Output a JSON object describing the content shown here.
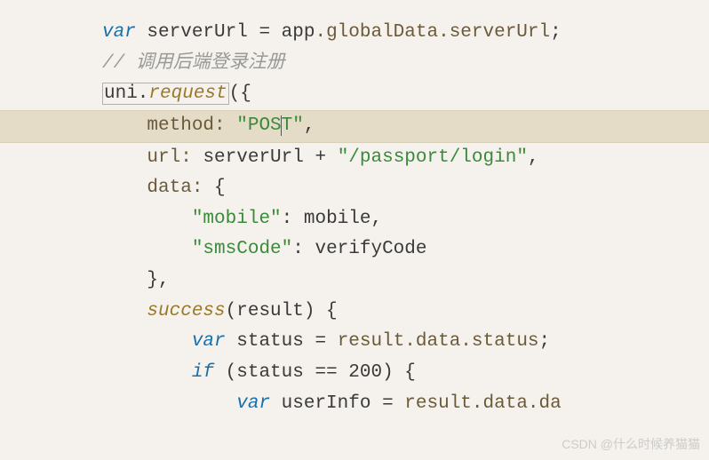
{
  "code": {
    "l1_var": "var",
    "l1_name": " serverUrl ",
    "l1_eq": "= ",
    "l1_rhs_a": "app",
    "l1_rhs_b": ".globalData.serverUrl",
    "l1_end": ";",
    "l2": "// 调用后端登录注册",
    "l3_a": "uni.",
    "l3_b": "request",
    "l3_c": "({",
    "l4_pad": "    ",
    "l4_key": "method: ",
    "l4_val_a": "\"POS",
    "l4_val_b": "T\"",
    "l4_end": ",",
    "l5_pad": "    ",
    "l5_key": "url: ",
    "l5_a": "serverUrl ",
    "l5_op": "+ ",
    "l5_str": "\"/passport/login\"",
    "l5_end": ",",
    "l6_pad": "    ",
    "l6_key": "data: ",
    "l6_b": "{",
    "l7_pad": "        ",
    "l7_key": "\"mobile\"",
    "l7_mid": ": ",
    "l7_val": "mobile",
    "l7_end": ",",
    "l8_pad": "        ",
    "l8_key": "\"smsCode\"",
    "l8_mid": ": ",
    "l8_val": "verifyCode",
    "l9_pad": "    ",
    "l9_a": "},",
    "l10_pad": "    ",
    "l10_fn": "success",
    "l10_b": "(result) {",
    "l11_pad": "        ",
    "l11_var": "var",
    "l11_name": " status ",
    "l11_eq": "= ",
    "l11_rhs": "result.data.status",
    "l11_end": ";",
    "l12_pad": "        ",
    "l12_if": "if",
    "l12_a": " (status ",
    "l12_op": "== ",
    "l12_num": "200",
    "l12_b": ") {",
    "l13_pad": "            ",
    "l13_var": "var",
    "l13_name": " userInfo ",
    "l13_eq": "= ",
    "l13_rhs": "result.data.da"
  },
  "watermark": "CSDN @什么时候养猫猫"
}
